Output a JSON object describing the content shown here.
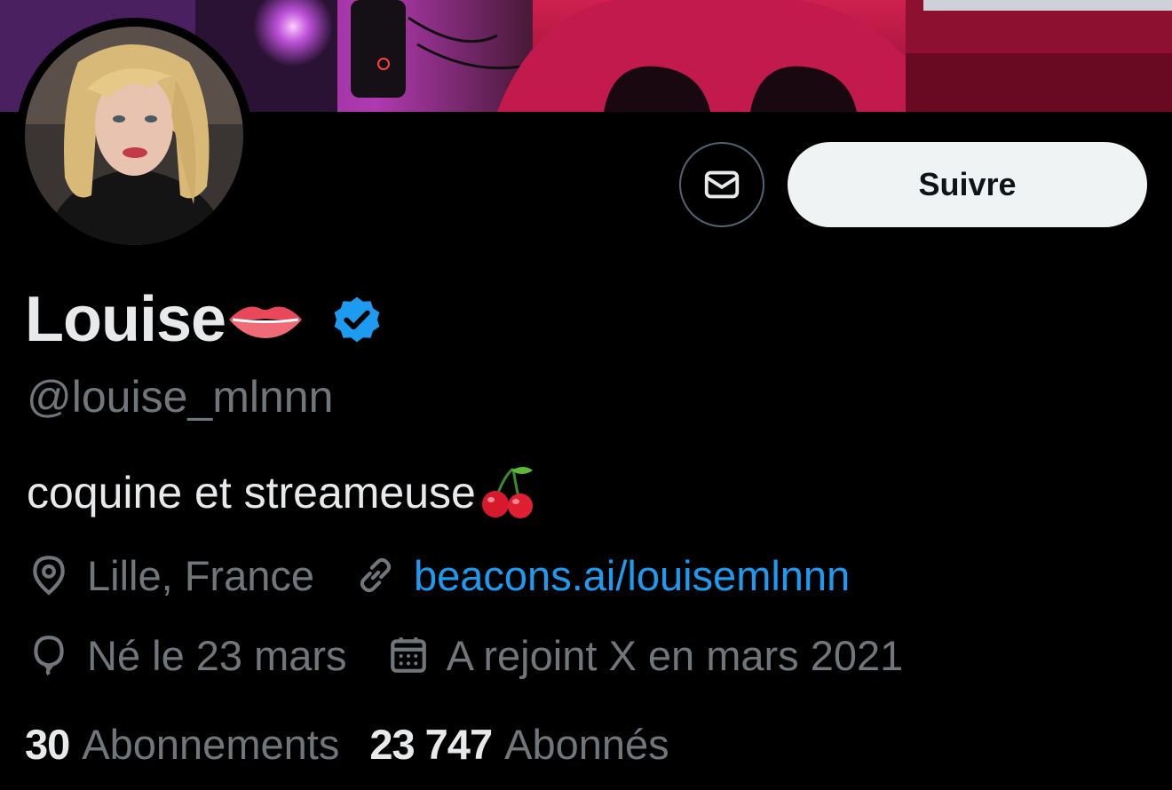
{
  "profile": {
    "display_name": "Louise",
    "handle": "@louise_mlnnn",
    "bio": "coquine et streameuse",
    "location": "Lille, France",
    "website": "beacons.ai/louisemlnnn",
    "birthday": "Né le 23 mars",
    "joined": "A rejoint X en mars 2021"
  },
  "actions": {
    "follow_label": "Suivre"
  },
  "stats": {
    "following_count": "30",
    "following_label": "Abonnements",
    "followers_count": "23 747",
    "followers_label": "Abonnés"
  },
  "icons": {
    "message": "envelope-icon",
    "verified": "verified-badge-icon",
    "location": "location-pin-icon",
    "link": "link-icon",
    "birthday": "balloon-icon",
    "calendar": "calendar-icon",
    "name_emoji": "lips-emoji",
    "bio_emoji": "cherries-emoji"
  },
  "colors": {
    "background": "#000000",
    "text_primary": "#e7e9ea",
    "text_secondary": "#71767b",
    "link": "#1d9bf0",
    "verified": "#1d9bf0",
    "follow_bg": "#eff3f4"
  }
}
